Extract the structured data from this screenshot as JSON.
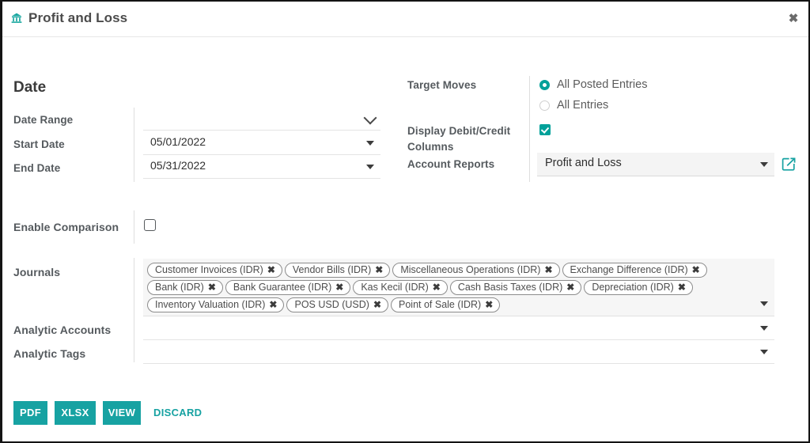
{
  "window": {
    "title": "Profit and Loss",
    "title_icon": "institution-icon",
    "close_icon": "close-icon"
  },
  "accent_color": "#17a2a2",
  "form": {
    "section_title": "Date",
    "date_range": {
      "label": "Date Range",
      "value": "",
      "icon": "chevron-down-icon"
    },
    "start_date": {
      "label": "Start Date",
      "value": "05/01/2022",
      "icon": "caret-down-icon"
    },
    "end_date": {
      "label": "End Date",
      "value": "05/31/2022",
      "icon": "caret-down-icon"
    },
    "target_moves": {
      "label": "Target Moves",
      "options": [
        {
          "label": "All Posted Entries",
          "selected": true
        },
        {
          "label": "All Entries",
          "selected": false
        }
      ]
    },
    "display_debit_credit": {
      "label": "Display Debit/Credit Columns",
      "label_line1": "Display Debit/Credit",
      "label_line2": "Columns",
      "checked": true
    },
    "account_reports": {
      "label": "Account Reports",
      "value": "Profit and Loss",
      "icon": "caret-down-icon",
      "external_link_icon": "external-link-icon"
    },
    "enable_comparison": {
      "label": "Enable Comparison",
      "checked": false
    },
    "journals": {
      "label": "Journals",
      "icon": "caret-down-icon",
      "remove_icon": "remove-tag-icon",
      "tags": [
        "Customer Invoices (IDR)",
        "Vendor Bills (IDR)",
        "Miscellaneous Operations (IDR)",
        "Exchange Difference (IDR)",
        "Bank (IDR)",
        "Bank Guarantee (IDR)",
        "Kas Kecil (IDR)",
        "Cash Basis Taxes (IDR)",
        "Depreciation (IDR)",
        "Inventory Valuation (IDR)",
        "POS USD (USD)",
        "Point of Sale (IDR)"
      ]
    },
    "analytic_accounts": {
      "label": "Analytic Accounts",
      "value": "",
      "icon": "caret-down-icon"
    },
    "analytic_tags": {
      "label": "Analytic Tags",
      "value": "",
      "icon": "caret-down-icon"
    }
  },
  "footer": {
    "pdf": "PDF",
    "xlsx": "XLSX",
    "view": "VIEW",
    "discard": "DISCARD"
  }
}
